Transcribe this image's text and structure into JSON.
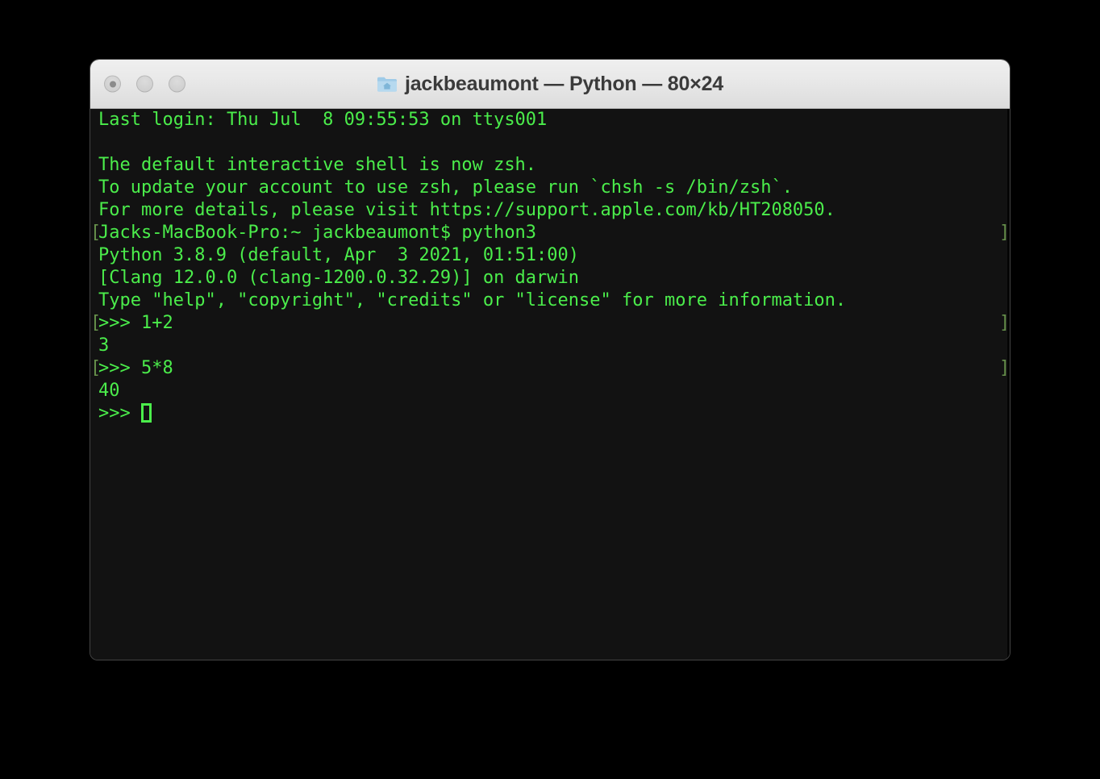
{
  "window": {
    "title": "jackbeaumont — Python — 80×24",
    "folder_icon_name": "home-folder-icon",
    "traffic_lights": [
      {
        "name": "close-button",
        "label": "Close"
      },
      {
        "name": "minimize-button",
        "label": "Minimize"
      },
      {
        "name": "zoom-button",
        "label": "Zoom"
      }
    ]
  },
  "colors": {
    "terminal_background": "#121212",
    "terminal_text": "#4bed4b",
    "prompt_mark": "#66904b",
    "titlebar_top": "#efefef",
    "titlebar_bottom": "#dcdcdc",
    "title_text": "#3b3b3b",
    "page_background": "#000000"
  },
  "terminal": {
    "lines": [
      {
        "text": "Last login: Thu Jul  8 09:55:53 on ttys001",
        "mark": false
      },
      {
        "text": "",
        "mark": false
      },
      {
        "text": "The default interactive shell is now zsh.",
        "mark": false
      },
      {
        "text": "To update your account to use zsh, please run `chsh -s /bin/zsh`.",
        "mark": false
      },
      {
        "text": "For more details, please visit https://support.apple.com/kb/HT208050.",
        "mark": false
      },
      {
        "text": "Jacks-MacBook-Pro:~ jackbeaumont$ python3",
        "mark": true
      },
      {
        "text": "Python 3.8.9 (default, Apr  3 2021, 01:51:00)",
        "mark": false
      },
      {
        "text": "[Clang 12.0.0 (clang-1200.0.32.29)] on darwin",
        "mark": false
      },
      {
        "text": "Type \"help\", \"copyright\", \"credits\" or \"license\" for more information.",
        "mark": false
      },
      {
        "text": ">>> 1+2",
        "mark": true
      },
      {
        "text": "3",
        "mark": false
      },
      {
        "text": ">>> 5*8",
        "mark": true
      },
      {
        "text": "40",
        "mark": false
      },
      {
        "text": ">>> ",
        "mark": false,
        "cursor": true
      }
    ],
    "mark_open": "[",
    "mark_close": "]"
  }
}
